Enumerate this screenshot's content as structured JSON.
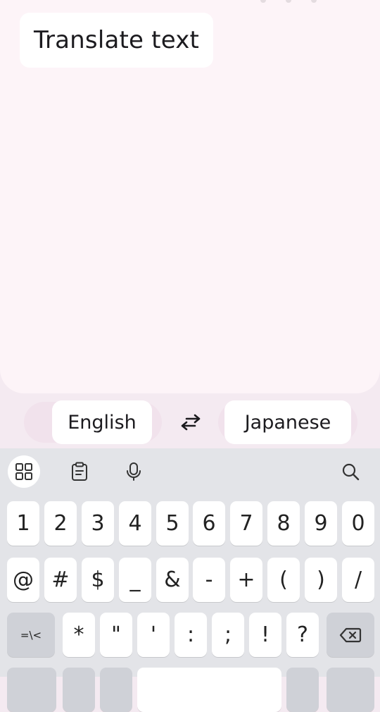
{
  "input": {
    "placeholder": "Translate text"
  },
  "languages": {
    "source": "English",
    "target": "Japanese"
  },
  "keyboard": {
    "row1": [
      "1",
      "2",
      "3",
      "4",
      "5",
      "6",
      "7",
      "8",
      "9",
      "0"
    ],
    "row2": [
      "@",
      "#",
      "$",
      "_",
      "&",
      "-",
      "+",
      "(",
      ")",
      "/"
    ],
    "row3_mode_key": "=\\<",
    "row3": [
      "*",
      "\"",
      "'",
      ":",
      ";",
      "!",
      "?"
    ]
  },
  "icons": {
    "swap": "swap-arrows-icon",
    "tools": [
      "apps-grid-icon",
      "clipboard-icon",
      "microphone-icon",
      "search-icon"
    ],
    "backspace": "backspace-icon"
  },
  "colors": {
    "background": "#f4eaf1",
    "card": "#fdf4f8",
    "keyboard": "#e3e4e8"
  }
}
